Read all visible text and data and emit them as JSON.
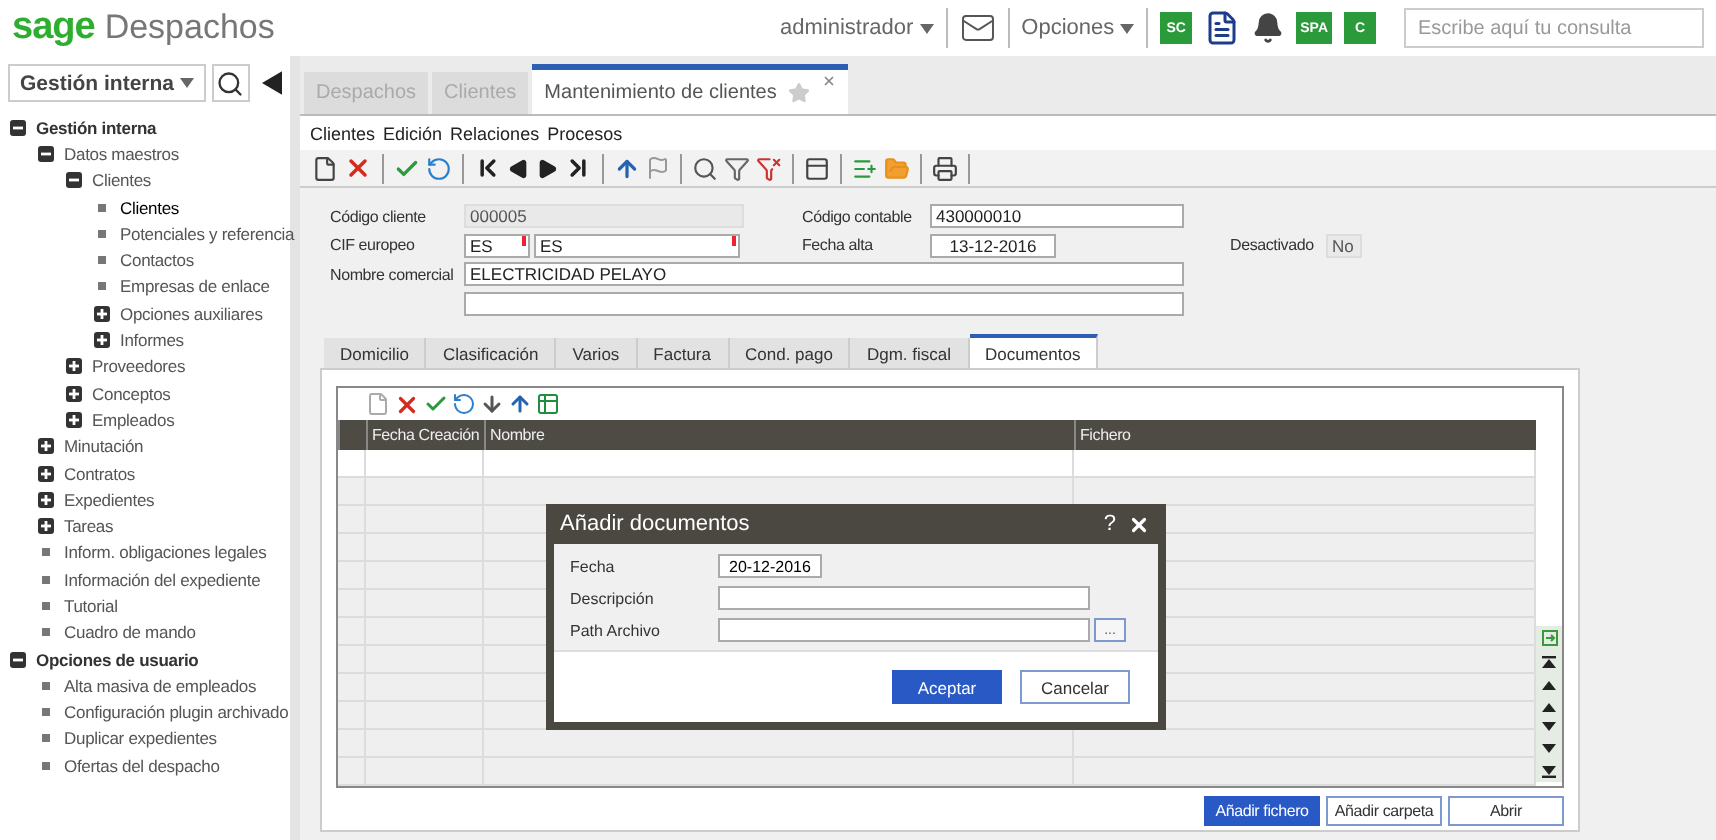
{
  "header": {
    "brand": "sage",
    "product": "Despachos",
    "user": "administrador",
    "options": "Opciones",
    "apps": [
      {
        "kind": "badge",
        "label": "SC"
      },
      {
        "kind": "tasks"
      },
      {
        "kind": "alerts"
      },
      {
        "kind": "badge",
        "label": "SPA"
      },
      {
        "kind": "badge",
        "label": "C"
      }
    ],
    "search": {
      "placeholder": "Escribe aquí tu consulta"
    }
  },
  "sidebar": {
    "module": "Gestión interna",
    "tree": [
      {
        "label": "Gestión interna",
        "kind": "folder",
        "expanded": true,
        "children": [
          {
            "label": "Datos maestros",
            "kind": "folder",
            "expanded": true,
            "children": [
              {
                "label": "Clientes",
                "kind": "folder",
                "expanded": true,
                "children": [
                  {
                    "label": "Clientes",
                    "kind": "leaf",
                    "selected": true
                  },
                  {
                    "label": "Potenciales y referencia",
                    "kind": "leaf",
                    "selected": false
                  },
                  {
                    "label": "Contactos",
                    "kind": "leaf",
                    "selected": false
                  },
                  {
                    "label": "Empresas de enlace",
                    "kind": "leaf",
                    "selected": false
                  },
                  {
                    "label": "Opciones auxiliares",
                    "kind": "folder",
                    "expanded": false
                  },
                  {
                    "label": "Informes",
                    "kind": "folder",
                    "expanded": false
                  }
                ]
              },
              {
                "label": "Proveedores",
                "kind": "folder",
                "expanded": false
              },
              {
                "label": "Conceptos",
                "kind": "folder",
                "expanded": false
              },
              {
                "label": "Empleados",
                "kind": "folder",
                "expanded": false
              }
            ]
          },
          {
            "label": "Minutación",
            "kind": "folder",
            "expanded": false
          },
          {
            "label": "Contratos",
            "kind": "folder",
            "expanded": false
          },
          {
            "label": "Expedientes",
            "kind": "folder",
            "expanded": false
          },
          {
            "label": "Tareas",
            "kind": "folder",
            "expanded": false
          },
          {
            "label": "Inform. obligaciones legales",
            "kind": "leaf",
            "selected": false
          },
          {
            "label": "Información del expediente",
            "kind": "leaf",
            "selected": false
          },
          {
            "label": "Tutorial",
            "kind": "leaf",
            "selected": false
          },
          {
            "label": "Cuadro de mando",
            "kind": "leaf",
            "selected": false
          }
        ]
      },
      {
        "label": "Opciones de usuario",
        "kind": "folder",
        "expanded": true,
        "children": [
          {
            "label": "Alta masiva de empleados",
            "kind": "leaf",
            "selected": false
          },
          {
            "label": "Configuración plugin archivado",
            "kind": "leaf",
            "selected": false
          },
          {
            "label": "Duplicar expedientes",
            "kind": "leaf",
            "selected": false
          },
          {
            "label": "Ofertas del despacho",
            "kind": "leaf",
            "selected": false
          }
        ]
      }
    ]
  },
  "tabs": [
    {
      "label": "Despachos",
      "selected": false
    },
    {
      "label": "Clientes",
      "selected": false
    },
    {
      "label": "Mantenimiento de clientes",
      "selected": true
    }
  ],
  "menu": [
    "Clientes",
    "Edición",
    "Relaciones",
    "Procesos"
  ],
  "form": {
    "client_code": {
      "label": "Código cliente",
      "value": "000005",
      "disabled": true
    },
    "account_code": {
      "label": "Código contable",
      "value": "430000010"
    },
    "vat_id": {
      "label": "CIF europeo",
      "country": "ES",
      "number": "ES",
      "required": true
    },
    "date_added": {
      "label": "Fecha alta",
      "value": "13-12-2016"
    },
    "deactivated": {
      "label": "Desactivado",
      "value": "No",
      "disabled": true
    },
    "trade_name": {
      "label": "Nombre comercial",
      "value": "ELECTRICIDAD PELAYO"
    }
  },
  "subtabs": [
    {
      "label": "Domicilio",
      "selected": false
    },
    {
      "label": "Clasificación",
      "selected": false
    },
    {
      "label": "Varios",
      "selected": false
    },
    {
      "label": "Factura",
      "selected": false
    },
    {
      "label": "Cond. pago",
      "selected": false
    },
    {
      "label": "Dgm. fiscal",
      "selected": false
    },
    {
      "label": "Documentos",
      "selected": true
    }
  ],
  "documents": {
    "columns": [
      "Fecha Creación",
      "Nombre",
      "Fichero"
    ],
    "buttons": [
      {
        "label": "Añadir fichero",
        "primary": true
      },
      {
        "label": "Añadir carpeta",
        "primary": false
      },
      {
        "label": "Abrir",
        "primary": false
      }
    ]
  },
  "dialog": {
    "title": "Añadir documentos",
    "help": "?",
    "fields": [
      {
        "label": "Fecha",
        "value": "20-12-2016",
        "kind": "date"
      },
      {
        "label": "Descripción",
        "kind": "text"
      },
      {
        "label": "Path Archivo",
        "kind": "browse",
        "browse": "..."
      }
    ],
    "buttons": [
      {
        "label": "Aceptar",
        "primary": true
      },
      {
        "label": "Cancelar",
        "primary": false
      }
    ]
  }
}
